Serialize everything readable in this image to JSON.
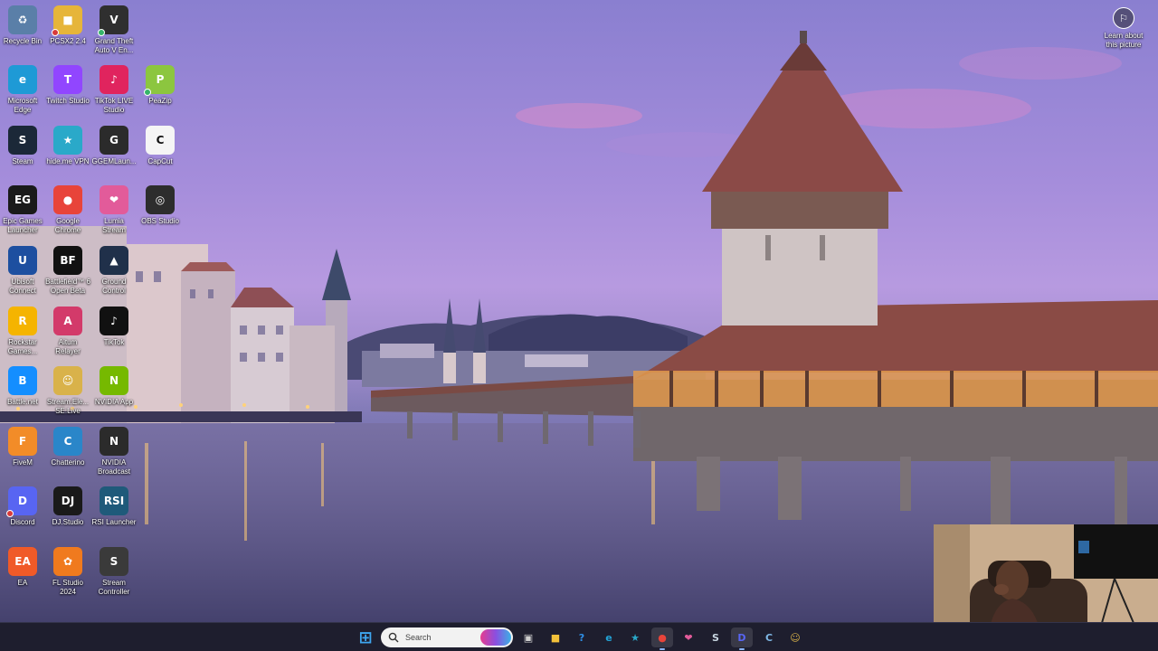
{
  "desktop": {
    "icons": [
      {
        "label": "Recycle Bin",
        "glyph": "♻",
        "color": "#5a7fa8",
        "icon": "recycle-bin-icon",
        "badge": ""
      },
      {
        "label": "PCSX2 2.4",
        "glyph": "■",
        "color": "#e6b53a",
        "icon": "folder-icon",
        "badge": "red"
      },
      {
        "label": "Grand Theft\nAuto V En...",
        "glyph": "V",
        "color": "#2f2f2f",
        "icon": "gta-icon",
        "badge": "green"
      },
      {
        "label": "Microsoft\nEdge",
        "glyph": "e",
        "color": "#1e9ad6",
        "icon": "edge-icon",
        "badge": ""
      },
      {
        "label": "Twitch Studio",
        "glyph": "T",
        "color": "#9146ff",
        "icon": "twitch-icon",
        "badge": ""
      },
      {
        "label": "TikTok LIVE\nStudio",
        "glyph": "♪",
        "color": "#e0245e",
        "icon": "tiktok-live-icon",
        "badge": ""
      },
      {
        "label": "PeaZip",
        "glyph": "P",
        "color": "#8cc63f",
        "icon": "peazip-icon",
        "badge": "green"
      },
      {
        "label": "Steam",
        "glyph": "S",
        "color": "#1b2838",
        "icon": "steam-icon",
        "badge": ""
      },
      {
        "label": "hide.me VPN",
        "glyph": "★",
        "color": "#2aa9c9",
        "icon": "vpn-icon",
        "badge": ""
      },
      {
        "label": "GGEMLaun...",
        "glyph": "G",
        "color": "#2b2b2b",
        "icon": "ggem-icon",
        "badge": ""
      },
      {
        "label": "CapCut",
        "glyph": "C",
        "color": "#f5f5f5",
        "icon": "capcut-icon",
        "badge": ""
      },
      {
        "label": "Epic Games\nLauncher",
        "glyph": "EG",
        "color": "#1a1a1a",
        "icon": "epic-games-icon",
        "badge": ""
      },
      {
        "label": "Google\nChrome",
        "glyph": "●",
        "color": "#e8443a",
        "icon": "chrome-icon",
        "badge": ""
      },
      {
        "label": "Lumia\nStream",
        "glyph": "❤",
        "color": "#e25b9a",
        "icon": "lumia-icon",
        "badge": ""
      },
      {
        "label": "OBS Studio",
        "glyph": "◎",
        "color": "#2d2d2d",
        "icon": "obs-icon",
        "badge": ""
      },
      {
        "label": "Ubisoft\nConnect",
        "glyph": "U",
        "color": "#1d4fa0",
        "icon": "ubisoft-icon",
        "badge": ""
      },
      {
        "label": "Battlefield™ 6\nOpen Beta",
        "glyph": "BF",
        "color": "#111111",
        "icon": "battlefield-icon",
        "badge": ""
      },
      {
        "label": "Ground\nControl",
        "glyph": "▲",
        "color": "#20304a",
        "icon": "ground-control-icon",
        "badge": ""
      },
      {
        "label": "Rockstar\nGames...",
        "glyph": "R",
        "color": "#f5b400",
        "icon": "rockstar-icon",
        "badge": ""
      },
      {
        "label": "Aitum\nRelayer",
        "glyph": "A",
        "color": "#d33a6a",
        "icon": "aitum-icon",
        "badge": ""
      },
      {
        "label": "TikTok",
        "glyph": "♪",
        "color": "#111111",
        "icon": "tiktok-icon",
        "badge": ""
      },
      {
        "label": "Battle.net",
        "glyph": "B",
        "color": "#148eff",
        "icon": "battlenet-icon",
        "badge": ""
      },
      {
        "label": "Stream.Ele...\nSE.Live",
        "glyph": "☺",
        "color": "#d9b24a",
        "icon": "streamelements-icon",
        "badge": ""
      },
      {
        "label": "NVIDIA App",
        "glyph": "N",
        "color": "#76b900",
        "icon": "nvidia-icon",
        "badge": ""
      },
      {
        "label": "FiveM",
        "glyph": "F",
        "color": "#f28c28",
        "icon": "fivem-icon",
        "badge": ""
      },
      {
        "label": "Chatterino",
        "glyph": "C",
        "color": "#2a86c9",
        "icon": "chatterino-icon",
        "badge": ""
      },
      {
        "label": "NVIDIA\nBroadcast",
        "glyph": "N",
        "color": "#2b2b2b",
        "icon": "nvidia-broadcast-icon",
        "badge": ""
      },
      {
        "label": "Discord",
        "glyph": "D",
        "color": "#5865f2",
        "icon": "discord-icon",
        "badge": "red"
      },
      {
        "label": "DJ.Studio",
        "glyph": "DJ",
        "color": "#1a1a1a",
        "icon": "djstudio-icon",
        "badge": ""
      },
      {
        "label": "RSI Launcher",
        "glyph": "RSI",
        "color": "#1f5a7a",
        "icon": "rsi-icon",
        "badge": ""
      },
      {
        "label": "EA",
        "glyph": "EA",
        "color": "#f05a28",
        "icon": "ea-icon",
        "badge": ""
      },
      {
        "label": "FL Studio\n2024",
        "glyph": "✿",
        "color": "#f07a1e",
        "icon": "fl-studio-icon",
        "badge": ""
      },
      {
        "label": "Stream\nController",
        "glyph": "S",
        "color": "#3a3a3a",
        "icon": "stream-controller-icon",
        "badge": ""
      }
    ],
    "learn_about": {
      "label": "Learn about\nthis picture",
      "glyph": "⚐"
    }
  },
  "taskbar": {
    "start_glyph": "⊞",
    "search_placeholder": "Search",
    "items": [
      {
        "name": "task-view",
        "glyph": "▣",
        "color": "#cfcfcf",
        "active": false
      },
      {
        "name": "file-explorer",
        "glyph": "■",
        "color": "#f3c13a",
        "active": false
      },
      {
        "name": "help",
        "glyph": "?",
        "color": "#2f8fe6",
        "active": false
      },
      {
        "name": "edge",
        "glyph": "e",
        "color": "#23a3d6",
        "active": false
      },
      {
        "name": "vpn",
        "glyph": "★",
        "color": "#2aa9c9",
        "active": false
      },
      {
        "name": "chrome",
        "glyph": "●",
        "color": "#e8443a",
        "active": true
      },
      {
        "name": "lumia",
        "glyph": "❤",
        "color": "#e25b9a",
        "active": false
      },
      {
        "name": "steam",
        "glyph": "S",
        "color": "#c7d5e0",
        "active": false
      },
      {
        "name": "discord",
        "glyph": "D",
        "color": "#5865f2",
        "active": true
      },
      {
        "name": "chatterino",
        "glyph": "C",
        "color": "#7fb8e6",
        "active": false
      },
      {
        "name": "streamelements",
        "glyph": "☺",
        "color": "#d9b24a",
        "active": false
      }
    ]
  }
}
